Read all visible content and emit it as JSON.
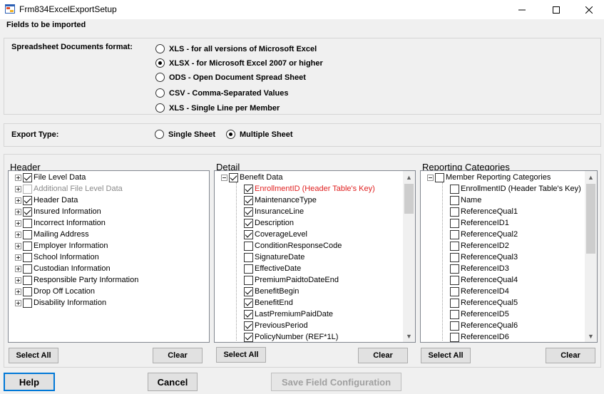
{
  "window": {
    "title": "Frm834ExcelExportSetup",
    "minimize_icon": "minimize-icon",
    "maximize_icon": "maximize-icon",
    "close_icon": "close-icon"
  },
  "fields_label": "Fields to be imported",
  "format": {
    "label": "Spreadsheet Documents format:",
    "options": [
      {
        "label": "XLS - for all versions of Microsoft Excel",
        "checked": false
      },
      {
        "label": "XLSX - for Microsoft Excel 2007 or higher",
        "checked": true
      },
      {
        "label": "ODS - Open Document Spread Sheet",
        "checked": false
      },
      {
        "label": "CSV - Comma-Separated Values",
        "checked": false
      },
      {
        "label": "XLS - Single Line per Member",
        "checked": false
      }
    ]
  },
  "export_type": {
    "label": "Export Type:",
    "options": [
      {
        "label": "Single Sheet",
        "checked": false
      },
      {
        "label": "Multiple Sheet",
        "checked": true
      }
    ]
  },
  "header_panel": {
    "title": "Header",
    "items": [
      {
        "label": "File Level Data",
        "checked": true,
        "style": "normal"
      },
      {
        "label": "Additional File Level Data",
        "checked": false,
        "style": "gray"
      },
      {
        "label": "Header Data",
        "checked": true,
        "style": "normal"
      },
      {
        "label": "Insured Information",
        "checked": true,
        "style": "normal"
      },
      {
        "label": "Incorrect Information",
        "checked": false,
        "style": "normal"
      },
      {
        "label": "Mailing Address",
        "checked": false,
        "style": "normal"
      },
      {
        "label": "Employer Information",
        "checked": false,
        "style": "normal"
      },
      {
        "label": "School Information",
        "checked": false,
        "style": "normal"
      },
      {
        "label": "Custodian Information",
        "checked": false,
        "style": "normal"
      },
      {
        "label": "Responsible Party Information",
        "checked": false,
        "style": "normal"
      },
      {
        "label": "Drop Off Location",
        "checked": false,
        "style": "normal"
      },
      {
        "label": "Disability Information",
        "checked": false,
        "style": "normal"
      }
    ],
    "select_all": "Select All",
    "clear": "Clear"
  },
  "detail_panel": {
    "title": "Detail",
    "root": {
      "label": "Benefit Data",
      "checked": true
    },
    "items": [
      {
        "label": "EnrollmentID (Header Table's Key)",
        "checked": true,
        "style": "red"
      },
      {
        "label": "MaintenanceType",
        "checked": true,
        "style": "normal"
      },
      {
        "label": "InsuranceLine",
        "checked": true,
        "style": "normal"
      },
      {
        "label": "Description",
        "checked": true,
        "style": "normal"
      },
      {
        "label": "CoverageLevel",
        "checked": true,
        "style": "normal"
      },
      {
        "label": "ConditionResponseCode",
        "checked": false,
        "style": "normal"
      },
      {
        "label": "SignatureDate",
        "checked": false,
        "style": "normal"
      },
      {
        "label": "EffectiveDate",
        "checked": false,
        "style": "normal"
      },
      {
        "label": "PremiumPaidtoDateEnd",
        "checked": false,
        "style": "normal"
      },
      {
        "label": "BenefitBegin",
        "checked": true,
        "style": "normal"
      },
      {
        "label": "BenefitEnd",
        "checked": true,
        "style": "normal"
      },
      {
        "label": "LastPremiumPaidDate",
        "checked": true,
        "style": "normal"
      },
      {
        "label": "PreviousPeriod",
        "checked": true,
        "style": "normal"
      },
      {
        "label": "PolicyNumber (REF*1L)",
        "checked": true,
        "style": "normal"
      }
    ],
    "select_all": "Select All",
    "clear": "Clear"
  },
  "reporting_panel": {
    "title": "Reporting Categories",
    "root": {
      "label": "Member Reporting Categories",
      "checked": false
    },
    "items": [
      {
        "label": "EnrollmentID (Header Table's Key)",
        "checked": false
      },
      {
        "label": "Name",
        "checked": false
      },
      {
        "label": "ReferenceQual1",
        "checked": false
      },
      {
        "label": "ReferenceID1",
        "checked": false
      },
      {
        "label": "ReferenceQual2",
        "checked": false
      },
      {
        "label": "ReferenceID2",
        "checked": false
      },
      {
        "label": "ReferenceQual3",
        "checked": false
      },
      {
        "label": "ReferenceID3",
        "checked": false
      },
      {
        "label": "ReferenceQual4",
        "checked": false
      },
      {
        "label": "ReferenceID4",
        "checked": false
      },
      {
        "label": "ReferenceQual5",
        "checked": false
      },
      {
        "label": "ReferenceID5",
        "checked": false
      },
      {
        "label": "ReferenceQual6",
        "checked": false
      },
      {
        "label": "ReferenceID6",
        "checked": false
      }
    ],
    "select_all": "Select All",
    "clear": "Clear"
  },
  "footer": {
    "help": "Help",
    "cancel": "Cancel",
    "save": "Save Field Configuration"
  },
  "colors": {
    "focus_border": "#0078d7",
    "highlight_red": "#e02020",
    "disabled_gray": "#8a8a8a"
  }
}
